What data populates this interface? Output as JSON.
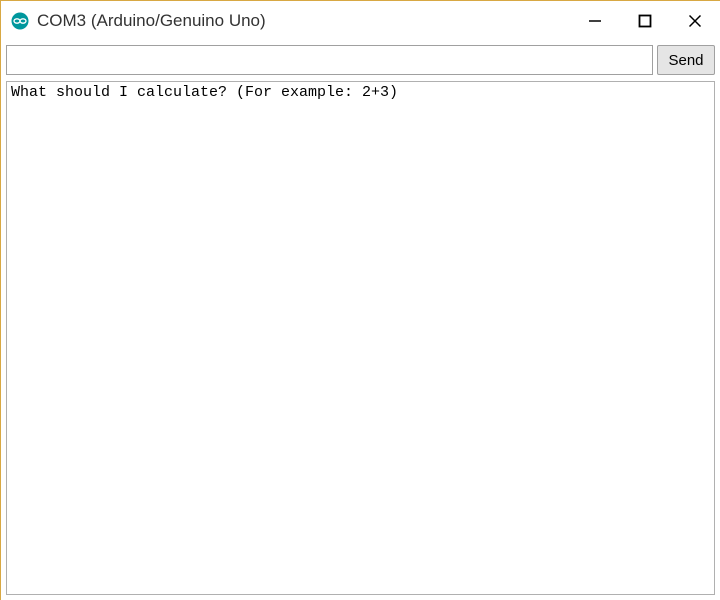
{
  "titlebar": {
    "title": "COM3 (Arduino/Genuino Uno)"
  },
  "icons": {
    "app": "arduino-icon",
    "minimize": "minimize-icon",
    "maximize": "maximize-icon",
    "close": "close-icon"
  },
  "inputRow": {
    "input_value": "",
    "input_placeholder": "",
    "send_label": "Send"
  },
  "output": {
    "text": "What should I calculate? (For example: 2+3)"
  },
  "colors": {
    "accent_border": "#d8a843",
    "arduino_teal": "#00979d"
  }
}
